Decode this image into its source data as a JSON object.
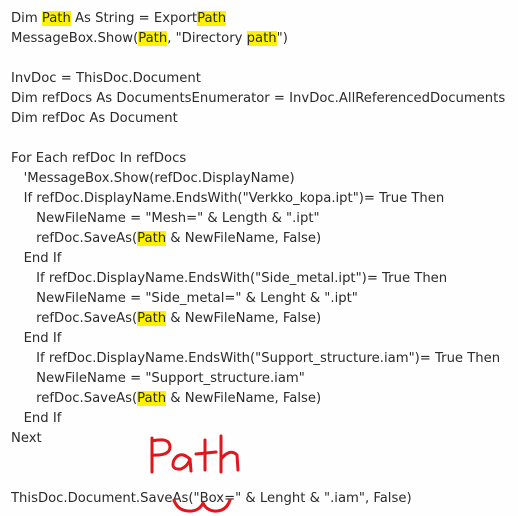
{
  "colors": {
    "highlight": "#fff200",
    "annotation": "#e0161c",
    "text": "#2b2b2b"
  },
  "lines": [
    [
      {
        "t": "Dim "
      },
      {
        "t": "Path",
        "hl": true
      },
      {
        "t": " As String = Export"
      },
      {
        "t": "Path",
        "hl": true
      }
    ],
    [
      {
        "t": "MessageBox.Show("
      },
      {
        "t": "Path",
        "hl": true
      },
      {
        "t": ", \"Directory "
      },
      {
        "t": "path",
        "hl": true
      },
      {
        "t": "\")"
      }
    ],
    [
      {
        "t": ""
      }
    ],
    [
      {
        "t": "InvDoc = ThisDoc.Document"
      }
    ],
    [
      {
        "t": "Dim refDocs As DocumentsEnumerator = InvDoc.AllReferencedDocuments"
      }
    ],
    [
      {
        "t": "Dim refDoc As Document"
      }
    ],
    [
      {
        "t": ""
      }
    ],
    [
      {
        "t": "For Each refDoc In refDocs"
      }
    ],
    [
      {
        "t": "   'MessageBox.Show(refDoc.DisplayName)"
      }
    ],
    [
      {
        "t": "   If refDoc.DisplayName.EndsWith(\"Verkko_kopa.ipt\")= True Then"
      }
    ],
    [
      {
        "t": "      NewFileName = \"Mesh=\" & Length & \".ipt\""
      }
    ],
    [
      {
        "t": "      refDoc.SaveAs("
      },
      {
        "t": "Path",
        "hl": true
      },
      {
        "t": " & NewFileName, False)"
      }
    ],
    [
      {
        "t": "   End If"
      }
    ],
    [
      {
        "t": "      If refDoc.DisplayName.EndsWith(\"Side_metal.ipt\")= True Then"
      }
    ],
    [
      {
        "t": "      NewFileName = \"Side_metal=\" & Lenght & \".ipt\""
      }
    ],
    [
      {
        "t": "      refDoc.SaveAs("
      },
      {
        "t": "Path",
        "hl": true
      },
      {
        "t": " & NewFileName, False)"
      }
    ],
    [
      {
        "t": "   End If"
      }
    ],
    [
      {
        "t": "      If refDoc.DisplayName.EndsWith(\"Support_structure.iam\")= True Then"
      }
    ],
    [
      {
        "t": "      NewFileName = \"Support_structure.iam\""
      }
    ],
    [
      {
        "t": "      refDoc.SaveAs("
      },
      {
        "t": "Path",
        "hl": true
      },
      {
        "t": " & NewFileName, False)"
      }
    ],
    [
      {
        "t": "   End If"
      }
    ],
    [
      {
        "t": "Next"
      }
    ],
    [
      {
        "t": ""
      }
    ],
    [
      {
        "t": ""
      }
    ],
    [
      {
        "t": "ThisDoc.Document.SaveAs(\"Box=\" & Lenght & \".iam\", False)"
      }
    ]
  ],
  "annotation": {
    "handwritten_text": "Path"
  }
}
